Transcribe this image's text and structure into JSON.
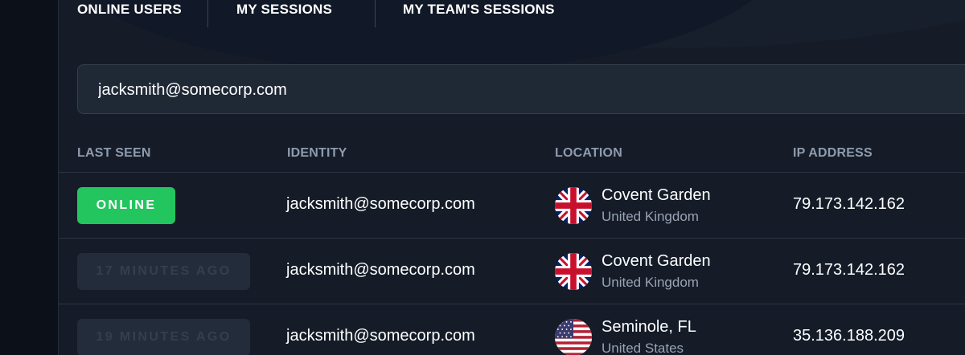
{
  "tabs": [
    {
      "label": "ONLINE USERS"
    },
    {
      "label": "MY SESSIONS"
    },
    {
      "label": "MY TEAM'S SESSIONS"
    }
  ],
  "search": {
    "value": "jacksmith@somecorp.com"
  },
  "table": {
    "headers": [
      "LAST SEEN",
      "IDENTITY",
      "LOCATION",
      "IP ADDRESS"
    ],
    "rows": [
      {
        "last_seen": "ONLINE",
        "status": "online",
        "identity": "jacksmith@somecorp.com",
        "city": "Covent Garden",
        "country": "United Kingdom",
        "flag": "uk-flag-icon",
        "ip": "79.173.142.162"
      },
      {
        "last_seen": "17 MINUTES AGO",
        "status": "ago",
        "identity": "jacksmith@somecorp.com",
        "city": "Covent Garden",
        "country": "United Kingdom",
        "flag": "uk-flag-icon",
        "ip": "79.173.142.162"
      },
      {
        "last_seen": "19 MINUTES AGO",
        "status": "ago",
        "identity": "jacksmith@somecorp.com",
        "city": "Seminole, FL",
        "country": "United States",
        "flag": "us-flag-icon",
        "ip": "35.136.188.209"
      }
    ]
  },
  "colors": {
    "online": "#22c55e",
    "background": "#151c28",
    "header_text": "#8f9bad"
  }
}
